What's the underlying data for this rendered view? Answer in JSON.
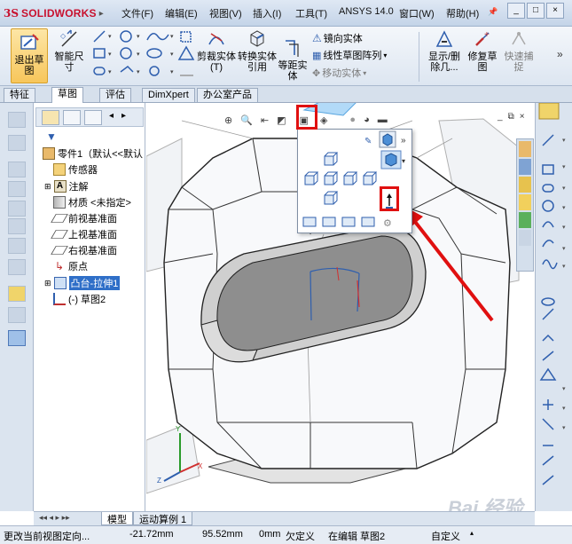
{
  "app": {
    "logo_ds": "3S",
    "logo_text": "SOLIDWORKS"
  },
  "menu": [
    "文件(F)",
    "编辑(E)",
    "视图(V)",
    "插入(I)",
    "工具(T)",
    "ANSYS 14.0",
    "窗口(W)",
    "帮助(H)"
  ],
  "window_controls": [
    "_",
    "□",
    "×"
  ],
  "toolbar": {
    "exit_sketch": "退出草图",
    "smart_dim": "智能尺寸",
    "trim": "剪裁实体(T)",
    "convert": "转换实体引用",
    "offset": "等距实体",
    "mirror": "镜向实体",
    "linear_pattern": "线性草图阵列",
    "move": "移动实体",
    "show_delete": "显示/删除几...",
    "repair": "修复草图",
    "quick_snap": "快速捕捉"
  },
  "tabs": [
    "特征",
    "草图",
    "评估",
    "DimXpert",
    "办公室产品"
  ],
  "active_tab": "草图",
  "tree": {
    "root": "零件1（默认<<默认",
    "items": [
      {
        "label": "传感器",
        "icon": "sensor-icon"
      },
      {
        "label": "注解",
        "icon": "annotation-icon"
      },
      {
        "label": "材质 <未指定>",
        "icon": "material-icon"
      },
      {
        "label": "前视基准面",
        "icon": "plane-icon"
      },
      {
        "label": "上视基准面",
        "icon": "plane-icon"
      },
      {
        "label": "右视基准面",
        "icon": "plane-icon"
      },
      {
        "label": "原点",
        "icon": "origin-icon"
      },
      {
        "label": "凸台-拉伸1",
        "icon": "extrude-icon"
      },
      {
        "label": "(-) 草图2",
        "icon": "sketch-icon"
      }
    ],
    "selected": "凸台-拉伸1"
  },
  "bottom_tabs": [
    "模型",
    "运动算例 1"
  ],
  "status": {
    "hint": "更改当前视图定向...",
    "x": "-21.72mm",
    "y": "95.52mm",
    "z": "0mm",
    "state": "欠定义",
    "editing": "在编辑 草图2",
    "units": "自定义"
  },
  "watermark": "Bai 经验",
  "colors": {
    "highlight_red": "#e01010",
    "accent_blue": "#2f6fc8"
  }
}
